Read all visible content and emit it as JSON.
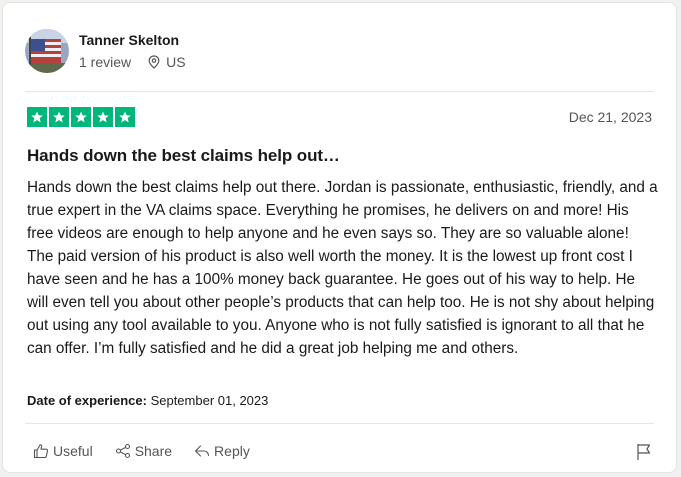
{
  "reviewer": {
    "name": "Tanner Skelton",
    "reviews": "1 review",
    "country": "US"
  },
  "review": {
    "rating": 5,
    "max_rating": 5,
    "date": "Dec 21, 2023",
    "title": "Hands down the best claims help out…",
    "body": "Hands down the best claims help out there. Jordan is passionate, enthusiastic, friendly, and a true expert in the VA claims space. Everything he promises, he delivers on and more! His free videos are enough to help anyone and he even says so. They are so valuable alone! The paid version of his product is also well worth the money. It is the lowest up front cost I have seen and he has a 100% money back guarantee. He goes out of his way to help. He will even tell you about other people’s products that can help too. He is not shy about helping out using any tool available to you. Anyone who is not fully satisfied is ignorant to all that he can offer. I’m fully satisfied and he did a great job helping me and others.",
    "experience_label": "Date of experience:",
    "experience_date": "September 01, 2023"
  },
  "actions": {
    "useful": "Useful",
    "share": "Share",
    "reply": "Reply"
  },
  "colors": {
    "star_green": "#00b67a",
    "text": "#1a1a1a",
    "muted": "#555555",
    "border": "#e5e5dd"
  },
  "icons": {
    "location": "map-pin-icon",
    "useful": "thumbs-up-icon",
    "share": "share-icon",
    "reply": "reply-icon",
    "flag": "flag-icon",
    "star": "star-icon"
  }
}
